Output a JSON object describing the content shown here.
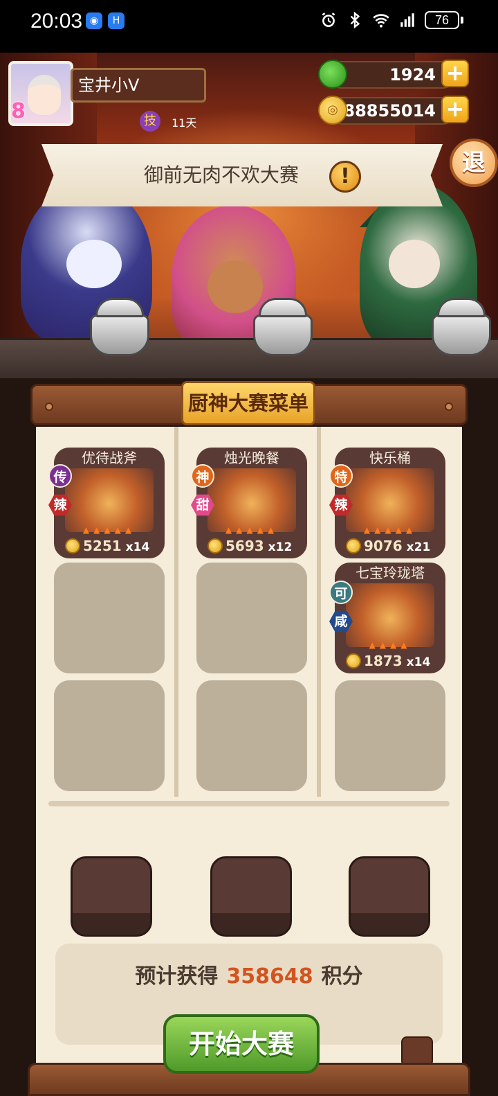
{
  "status_bar": {
    "time": "20:03",
    "battery": "76",
    "icons": [
      "app-badge-icon",
      "app-h-icon",
      "alarm-icon",
      "bluetooth-icon",
      "wifi-icon",
      "signal-icon"
    ]
  },
  "player": {
    "name": "宝井小V",
    "level": "8",
    "skill_badge": "技",
    "skill_days": "11天"
  },
  "currency": {
    "jade": "1924",
    "gold": "88855014",
    "plus": "+"
  },
  "exit_label": "退",
  "banner": {
    "title": "御前无肉不欢大赛",
    "alert": "!"
  },
  "menu": {
    "title": "厨神大赛菜单",
    "dishes": [
      {
        "name": "优待战斧",
        "tag1": "传",
        "tag2": "辣",
        "price": "5251",
        "qty": "x14"
      },
      {
        "name": "烛光晚餐",
        "tag1": "神",
        "tag2": "甜",
        "price": "5693",
        "qty": "x12"
      },
      {
        "name": "快乐桶",
        "tag1": "特",
        "tag2": "辣",
        "price": "9076",
        "qty": "x21"
      },
      {
        "name": "七宝玲珑塔",
        "tag1": "可",
        "tag2": "咸",
        "price": "1873",
        "qty": "x14"
      }
    ]
  },
  "score": {
    "prefix": "预计获得",
    "value": "358648",
    "suffix": "积分"
  },
  "start_button": "开始大赛",
  "colors": {
    "accent_orange": "#d2541e",
    "button_green": "#4e9a2a",
    "panel_bg": "#f5ecda",
    "title_gold": "#e7a32a"
  }
}
